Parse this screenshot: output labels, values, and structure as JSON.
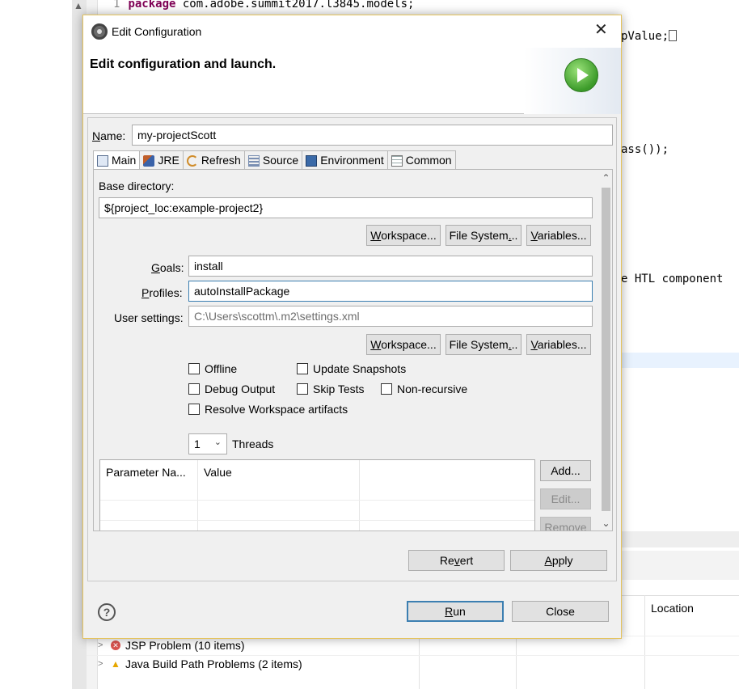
{
  "ide": {
    "code_line1_num": "1",
    "code_line1_kw": "package",
    "code_line1_rest": " com.adobe.summit2017.l3845.models;",
    "frag_value": "pValue;",
    "frag_class": "ass());",
    "frag_comment": "e HTL component",
    "problems": {
      "location_header": "Location",
      "rows": [
        {
          "label": "JSP Problem (10 items)"
        },
        {
          "label": "Java Build Path Problems (2 items)"
        }
      ]
    }
  },
  "dialog": {
    "title": "Edit Configuration",
    "banner": "Edit configuration and launch.",
    "name_label": "Name:",
    "name_value": "my-projectScott",
    "tabs": [
      {
        "label": "Main",
        "icon": "main-tab-icon"
      },
      {
        "label": "JRE",
        "icon": "jre-icon"
      },
      {
        "label": "Refresh",
        "icon": "refresh-icon"
      },
      {
        "label": "Source",
        "icon": "source-icon"
      },
      {
        "label": "Environment",
        "icon": "environment-icon"
      },
      {
        "label": "Common",
        "icon": "common-icon"
      }
    ],
    "main": {
      "base_dir_label": "Base directory:",
      "base_dir_value": "${project_loc:example-project2}",
      "workspace_btn": "Workspace...",
      "filesystem_btn": "File System...",
      "variables_btn": "Variables...",
      "goals_label": "Goals:",
      "goals_value": "install",
      "profiles_label": "Profiles:",
      "profiles_value": "autoInstallPackage",
      "user_settings_label": "User settings:",
      "user_settings_placeholder": "C:\\Users\\scottm\\.m2\\settings.xml",
      "offline": "Offline",
      "update_snapshots": "Update Snapshots",
      "debug_output": "Debug Output",
      "skip_tests": "Skip Tests",
      "non_recursive": "Non-recursive",
      "resolve_workspace": "Resolve Workspace artifacts",
      "threads_value": "1",
      "threads_label": "Threads",
      "param_col_name": "Parameter Na...",
      "param_col_value": "Value",
      "add_btn": "Add...",
      "edit_btn": "Edit...",
      "remove_btn": "Remove"
    },
    "revert_btn": "Revert",
    "apply_btn": "Apply",
    "run_btn": "Run",
    "close_btn": "Close"
  }
}
